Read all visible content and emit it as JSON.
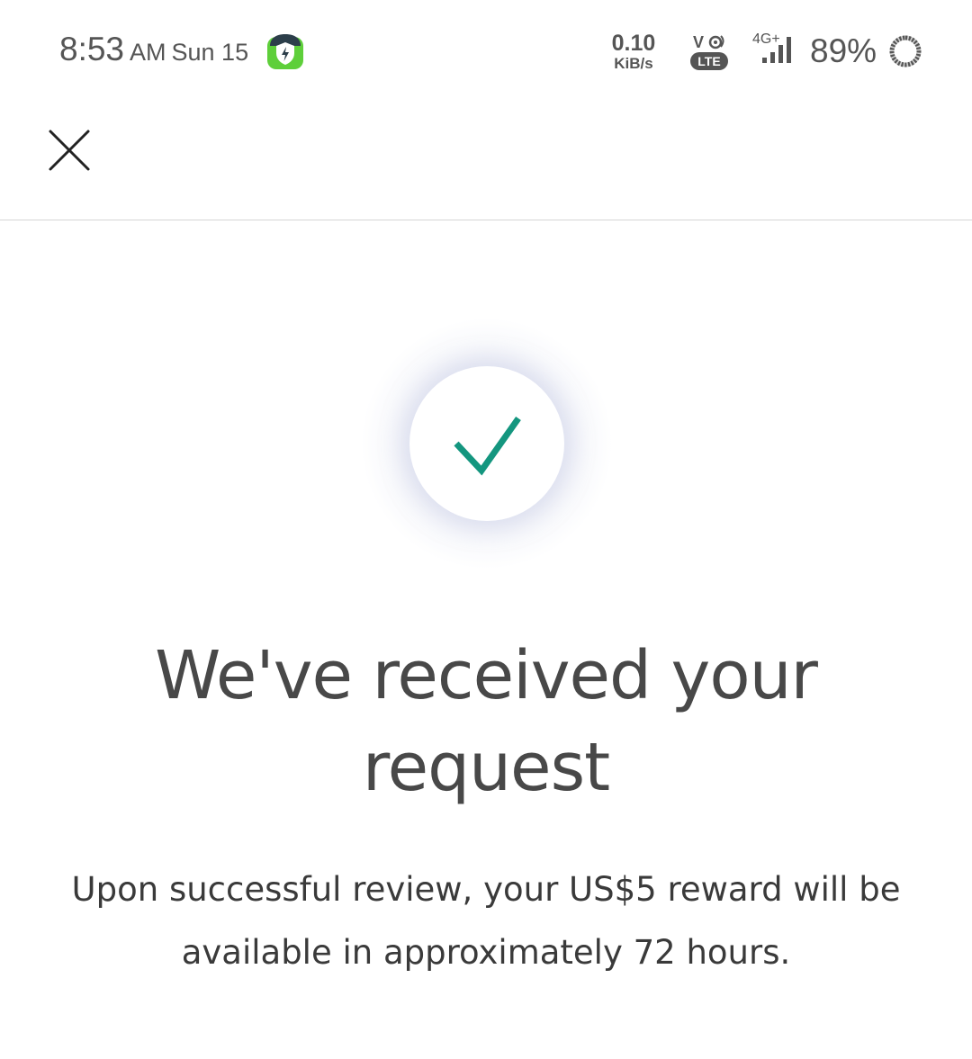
{
  "status_bar": {
    "time": "8:53",
    "ampm": "AM",
    "date": "Sun 15",
    "net_speed_value": "0.10",
    "net_speed_unit": "KiB/s",
    "volte_label": "LTE",
    "network_type": "4G+",
    "battery_percent": "89%",
    "icons": {
      "security": "shield-bolt-icon",
      "volte": "volte-icon",
      "signal": "cellular-signal-icon",
      "battery": "battery-ring-icon"
    },
    "colors": {
      "shield_green": "#5ecf3a",
      "shield_dark": "#2c3e4a"
    }
  },
  "header": {
    "close_icon": "close-icon"
  },
  "confirmation": {
    "title": "We've received your request",
    "message": "Upon successful review, your US$5 reward will be available in approximately 72 hours.",
    "icon": "checkmark-icon",
    "accent_color": "#14967f"
  }
}
